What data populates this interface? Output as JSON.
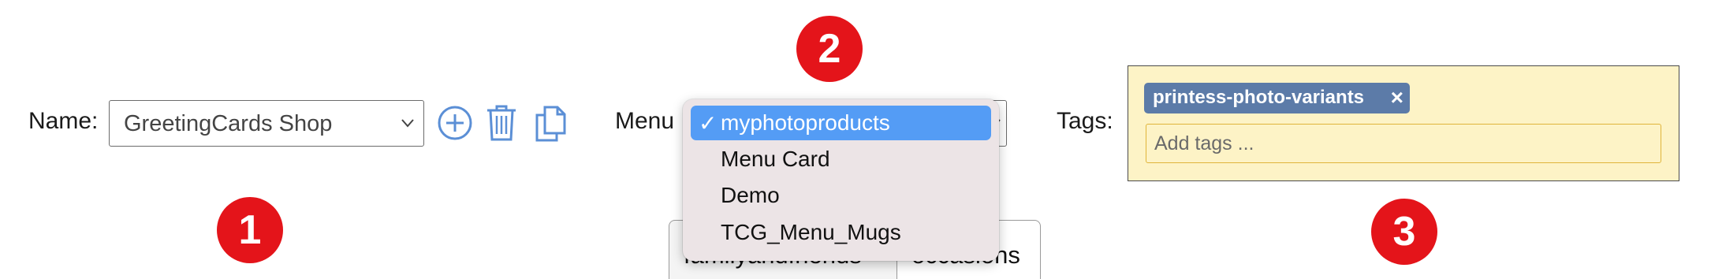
{
  "name_field": {
    "label": "Name:",
    "value": "GreetingCards Shop"
  },
  "name_actions": [
    "add-icon",
    "trash-icon",
    "copy-icon"
  ],
  "menu_field": {
    "label": "Menu"
  },
  "menu_dropdown": {
    "selected_mark": "✓",
    "options": [
      "myphotoproducts",
      "Menu Card",
      "Demo",
      "TCG_Menu_Mugs"
    ],
    "selected_index": 0
  },
  "tabs": [
    "familyandfriends",
    "occasions"
  ],
  "tags_field": {
    "label": "Tags:",
    "tags": [
      {
        "text": "printess-photo-variants",
        "remove": "×"
      }
    ],
    "input_placeholder": "Add tags ..."
  },
  "badges": [
    "1",
    "2",
    "3"
  ],
  "colors": {
    "accent_blue": "#549cf5",
    "icon_blue": "#5b8fd6",
    "badge_red": "#e4141a",
    "tag_chip": "#5c7ba8",
    "tags_background": "#fdf3c6",
    "tag_input_border": "#e0b43a"
  }
}
